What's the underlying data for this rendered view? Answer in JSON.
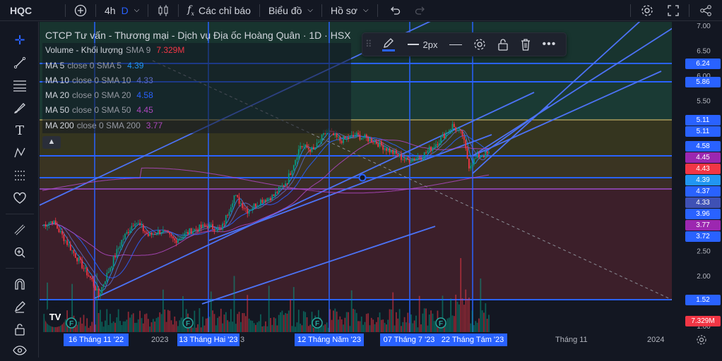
{
  "topbar": {
    "symbol": "HQC",
    "interval": "4h",
    "interval_alt": "D",
    "indicators_label": "Các chỉ báo",
    "chart_label": "Biểu đồ",
    "profile_label": "Hồ sơ"
  },
  "legend": {
    "title": "CTCP Tư vấn - Thương mại - Dịch vụ Địa ốc Hoàng Quân · 1D · HSX",
    "rows": [
      {
        "name": "Volume - Khối lượng",
        "params": "SMA 9",
        "value": "7.329M",
        "color": "#f23645"
      },
      {
        "name": "MA 5",
        "params": "close 0 SMA 5",
        "value": "4.39",
        "color": "#2196f3"
      },
      {
        "name": "MA 10",
        "params": "close 0 SMA 10",
        "value": "4.33",
        "color": "#3f51b5"
      },
      {
        "name": "MA 20",
        "params": "close 0 SMA 20",
        "value": "4.58",
        "color": "#2962ff"
      },
      {
        "name": "MA 50",
        "params": "close 0 SMA 50",
        "value": "4.45",
        "color": "#9c27b0"
      },
      {
        "name": "MA 200",
        "params": "close 0 SMA 200",
        "value": "3.77",
        "color": "#9c27b0"
      }
    ]
  },
  "drawing_toolbar": {
    "width_label": "2px"
  },
  "price_axis": {
    "ticks": [
      "7.00",
      "6.50",
      "6.00",
      "5.50",
      "3.50",
      "3.00",
      "2.50",
      "2.00",
      "1.00"
    ],
    "labels": [
      {
        "text": "6.24",
        "color": "#2962ff",
        "price": 6.24
      },
      {
        "text": "5.86",
        "color": "#2962ff",
        "price": 5.86
      },
      {
        "text": "5.11",
        "color": "#2962ff",
        "price": 5.11
      },
      {
        "text": "5.11",
        "color": "#2962ff",
        "price": 5.11
      },
      {
        "text": "4.58",
        "color": "#2962ff",
        "price": 4.58
      },
      {
        "text": "4.45",
        "color": "#9c27b0",
        "price": 4.45
      },
      {
        "text": "4.43",
        "color": "#f23645",
        "price": 4.43
      },
      {
        "text": "4.39",
        "color": "#2196f3",
        "price": 4.39
      },
      {
        "text": "4.37",
        "color": "#2962ff",
        "price": 4.37
      },
      {
        "text": "4.33",
        "color": "#3f51b5",
        "price": 4.33
      },
      {
        "text": "3.96",
        "color": "#2962ff",
        "price": 3.96
      },
      {
        "text": "3.77",
        "color": "#9c27b0",
        "price": 3.77
      },
      {
        "text": "3.72",
        "color": "#2962ff",
        "price": 3.72
      },
      {
        "text": "1.52",
        "color": "#2962ff",
        "price": 1.52
      },
      {
        "text": "7.329M",
        "color": "#f23645",
        "price": 1.06
      }
    ]
  },
  "time_axis": {
    "highlighted": [
      "16 Tháng 11 '22",
      "13 Tháng Hai '23",
      "12 Tháng Năm '23",
      "07 Tháng 7 '23",
      "22 Tháng Tám '23"
    ],
    "ticks": [
      "2023",
      "3",
      "Tháng 11",
      "2024"
    ]
  },
  "colors": {
    "accent": "#2962ff",
    "up": "#089981",
    "down": "#f23645",
    "bg": "#131722"
  }
}
